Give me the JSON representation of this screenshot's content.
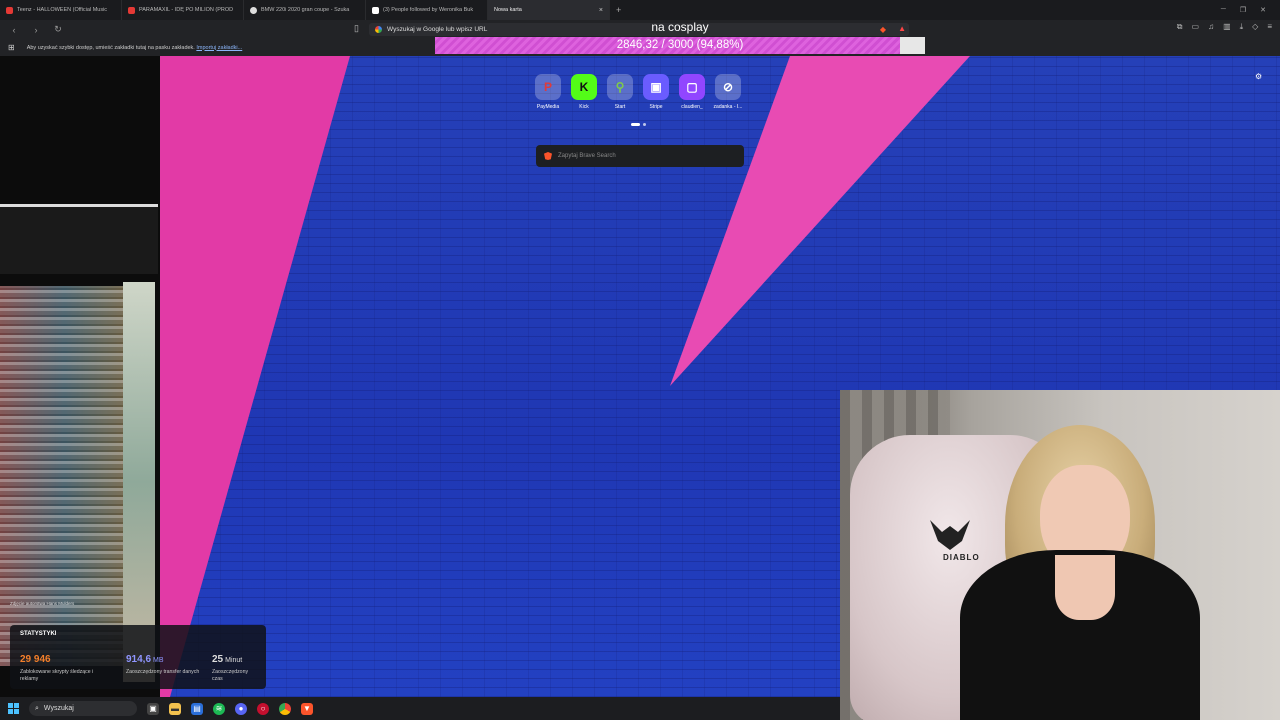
{
  "tabs": [
    {
      "label": "Teenz - HALLOWEEN (Official Music",
      "color": "#e53935"
    },
    {
      "label": "PARAMAXIL - IDĘ PO MILION (PROD",
      "color": "#e53935"
    },
    {
      "label": "BMW 220i 2020 gran coupe - Szuka",
      "color": "#dddddd"
    },
    {
      "label": "(3) People followed by Weronika Buk",
      "color": "#ffffff"
    },
    {
      "label": "Nowa karta",
      "color": "#444444"
    }
  ],
  "new_tab_symbol": "+",
  "tab_close_symbol": "×",
  "url_bar": {
    "placeholder": "Wyszukaj w Google lub wpisz URL"
  },
  "bookmarks_bar": {
    "text": "Aby uzyskać szybki dostęp, umieść zakładki tutaj na pasku zakładek.",
    "link": "Importuj zakładki..."
  },
  "stream_overlay": {
    "title": "na cosplay",
    "goal_text": "2846,32 / 3000 (94,88%)",
    "goal_fraction": 0.9488,
    "fill_color": "#de62de"
  },
  "speed_dial": [
    {
      "label": "PayMedia",
      "glyph": "P",
      "color": "#e03a3a",
      "icon": "paymedia-icon"
    },
    {
      "label": "Kick",
      "glyph": "K",
      "color": "#53fc18",
      "icon": "kick-icon"
    },
    {
      "label": "Start",
      "glyph": "⚲",
      "color": "#7ecb4a",
      "icon": "start-icon"
    },
    {
      "label": "Stripe",
      "glyph": "▣",
      "color": "#6a5cff",
      "icon": "stripe-icon"
    },
    {
      "label": "claudien_",
      "glyph": "▢",
      "color": "#9146ff",
      "icon": "twitch-icon"
    },
    {
      "label": "zadanka - I...",
      "glyph": "⊘",
      "color": "#ffffff",
      "icon": "zadanka-icon"
    }
  ],
  "search": {
    "placeholder": "Zapytaj Brave Search"
  },
  "photo_credit": "Zdjęcie autorstwa Hans Mulders",
  "stats": {
    "title": "STATYSTYKI",
    "items": [
      {
        "value": "29 946",
        "unit": "",
        "desc": "Zablokowane skrypty śledzące i reklamy",
        "color": "#f47f2a"
      },
      {
        "value": "914,6",
        "unit": "MB",
        "desc": "Zaoszczędzony transfer danych",
        "color": "#8f96ff"
      },
      {
        "value": "25",
        "unit": "Minut",
        "desc": "Zaoszczędzony czas",
        "color": "#ffffff"
      }
    ]
  },
  "webcam": {
    "chair_brand": "DIABLO"
  },
  "taskbar": {
    "search_label": "Wyszukaj"
  }
}
